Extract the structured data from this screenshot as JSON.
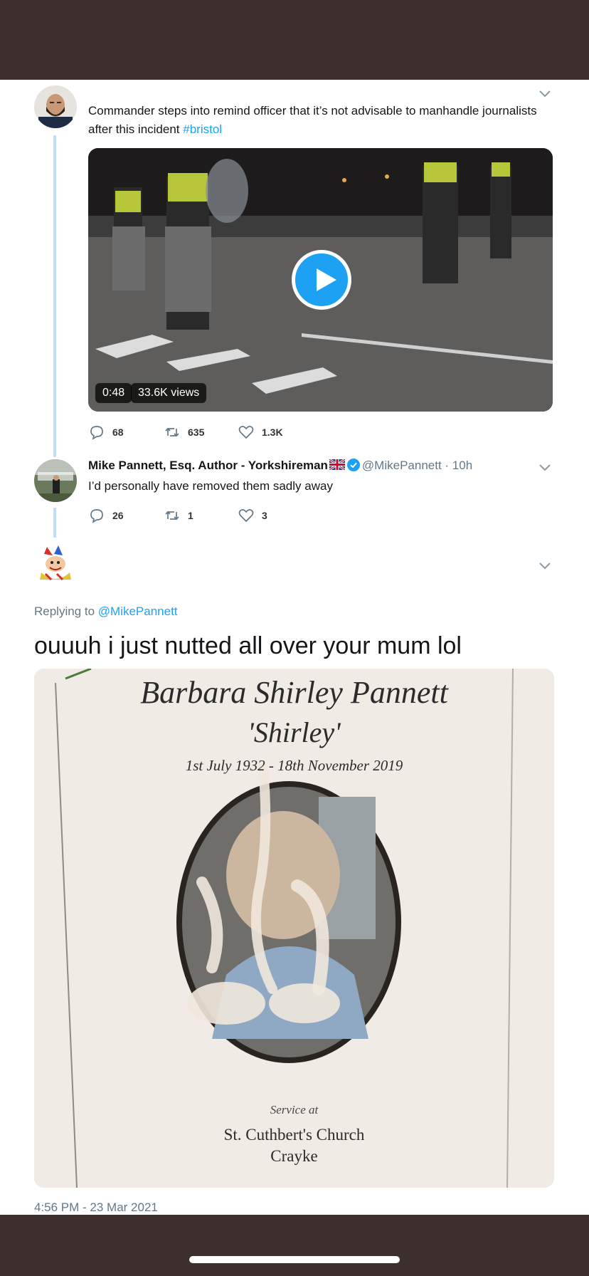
{
  "thread": {
    "tweet1": {
      "text": "Commander steps into remind officer that it’s not advisable to manhandle journalists after this incident ",
      "hashtag": "#bristol",
      "video": {
        "duration": "0:48",
        "views": "33.6K views",
        "play_icon": "play-icon"
      },
      "actions": {
        "replies": "68",
        "retweets": "635",
        "likes": "1.3K"
      }
    },
    "tweet2": {
      "name": "Mike Pannett, Esq. Author - Yorkshireman",
      "handle": "@MikePannett · 10h",
      "text": "I’d personally have removed them sadly away",
      "actions": {
        "replies": "26",
        "retweets": "1",
        "likes": "3"
      }
    }
  },
  "focused_tweet": {
    "replying_to_prefix": "Replying to ",
    "replying_to_handle": "@MikePannett",
    "text": "ouuuh i just nutted all over your mum lol",
    "timestamp": "4:56 PM - 23 Mar 2021",
    "image_card": {
      "name": "Barbara Shirley Pannett",
      "nickname": "'Shirley'",
      "dates": "1st July 1932 - 18th November 2019",
      "service_label": "Service at",
      "church": "St. Cuthbert's Church",
      "town": "Crayke"
    }
  },
  "icons": {
    "reply": "reply-icon",
    "retweet": "retweet-icon",
    "like": "heart-icon",
    "more": "chevron-down-icon",
    "verified": "verified-badge-icon",
    "flag": "uk-flag-icon"
  },
  "colors": {
    "link": "#1da1f2",
    "secondary_text": "#657786",
    "thread_line": "#c2ddf5",
    "frame": "#3d2f2d"
  }
}
